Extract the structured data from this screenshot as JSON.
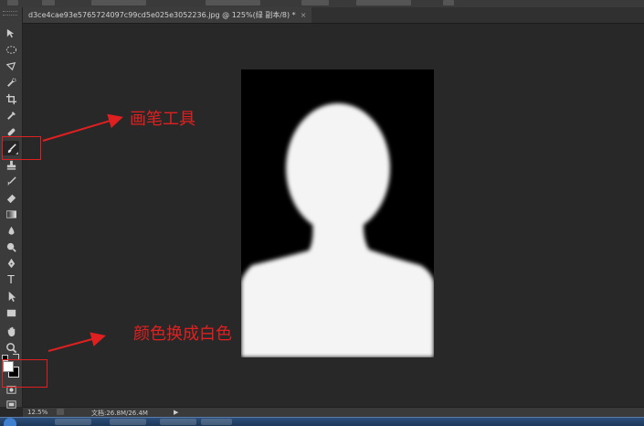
{
  "document": {
    "tab_title": "d3ce4cae93e5765724097c99cd5e025e3052236.jpg @ 125%(绿 副本/8) *",
    "close_glyph": "×"
  },
  "toolbox": {
    "tools": [
      {
        "name": "move-tool",
        "icon": "move-icon"
      },
      {
        "name": "marquee-tool",
        "icon": "ellipse-marquee-icon"
      },
      {
        "name": "lasso-tool",
        "icon": "lasso-icon"
      },
      {
        "name": "quick-selection-tool",
        "icon": "quick-selection-icon"
      },
      {
        "name": "crop-tool",
        "icon": "crop-icon"
      },
      {
        "name": "eyedropper-tool",
        "icon": "eyedropper-icon"
      },
      {
        "name": "healing-brush-tool",
        "icon": "bandage-icon"
      },
      {
        "name": "brush-tool",
        "icon": "brush-icon",
        "selected": true
      },
      {
        "name": "clone-stamp-tool",
        "icon": "stamp-icon"
      },
      {
        "name": "history-brush-tool",
        "icon": "history-brush-icon"
      },
      {
        "name": "eraser-tool",
        "icon": "eraser-icon"
      },
      {
        "name": "gradient-tool",
        "icon": "gradient-icon"
      },
      {
        "name": "blur-tool",
        "icon": "drop-icon"
      },
      {
        "name": "dodge-tool",
        "icon": "dodge-icon"
      },
      {
        "name": "pen-tool",
        "icon": "pen-icon"
      },
      {
        "name": "type-tool",
        "icon": "type-icon"
      },
      {
        "name": "path-selection-tool",
        "icon": "arrow-icon"
      },
      {
        "name": "shape-tool",
        "icon": "rectangle-icon"
      },
      {
        "name": "hand-tool",
        "icon": "hand-icon"
      },
      {
        "name": "zoom-tool",
        "icon": "zoom-icon"
      }
    ],
    "type_glyph": "T",
    "foreground_color": "#ffffff",
    "background_color": "#000000"
  },
  "status": {
    "zoom": "12.5%",
    "doc_info": "文档:26.8M/26.4M",
    "arrow_glyph": "▶"
  },
  "annotations": {
    "brush_label": "画笔工具",
    "color_label": "颜色换成白色",
    "color": "#e02020"
  }
}
